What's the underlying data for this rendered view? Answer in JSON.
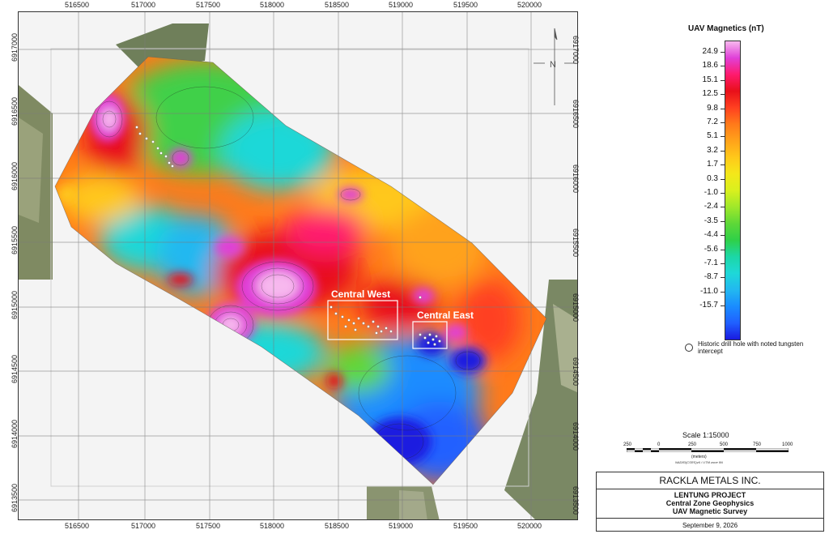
{
  "map": {
    "easting_ticks": [
      "516500",
      "517000",
      "517500",
      "518000",
      "518500",
      "519000",
      "519500",
      "520000"
    ],
    "northing_ticks": [
      "6917000",
      "6916500",
      "6916000",
      "6915500",
      "6915000",
      "6914500",
      "6914000",
      "6913500"
    ],
    "areas": [
      {
        "label": "Central West"
      },
      {
        "label": "Central East"
      }
    ],
    "north_arrow": "north-arrow-icon"
  },
  "legend": {
    "title": "UAV Magnetics (nT)",
    "values": [
      "24.9",
      "18.6",
      "15.1",
      "12.5",
      "9.8",
      "7.2",
      "5.1",
      "3.2",
      "1.7",
      "0.3",
      "-1.0",
      "-2.4",
      "-3.5",
      "-4.4",
      "-5.6",
      "-7.1",
      "-8.7",
      "-11.0",
      "-15.7"
    ],
    "colors": [
      "#f7b8ee",
      "#e040d8",
      "#ff1a6e",
      "#e8101a",
      "#ff4020",
      "#ff7a1a",
      "#ffa21a",
      "#ffc81a",
      "#f4e81a",
      "#d9f01e",
      "#9fe82a",
      "#5ed838",
      "#2fd048",
      "#1cd7a6",
      "#1ed8d8",
      "#22b8f0",
      "#1a8cff",
      "#2060ff",
      "#1a1ae0"
    ],
    "drill_hole_label": "Historic drill hole with noted tungsten intercept"
  },
  "scale": {
    "title": "Scale 1:15000",
    "ticks": [
      "250",
      "0",
      "250",
      "500",
      "750",
      "1000"
    ],
    "units": "(meters)",
    "projection": "NAD83(CSRS)v6 / UTM zone 9N"
  },
  "title_block": {
    "company": "RACKLA METALS INC.",
    "project": "LENTUNG PROJECT",
    "subtitle1": "Central Zone Geophysics",
    "subtitle2": "UAV Magnetic Survey",
    "date": "September 9, 2026"
  }
}
